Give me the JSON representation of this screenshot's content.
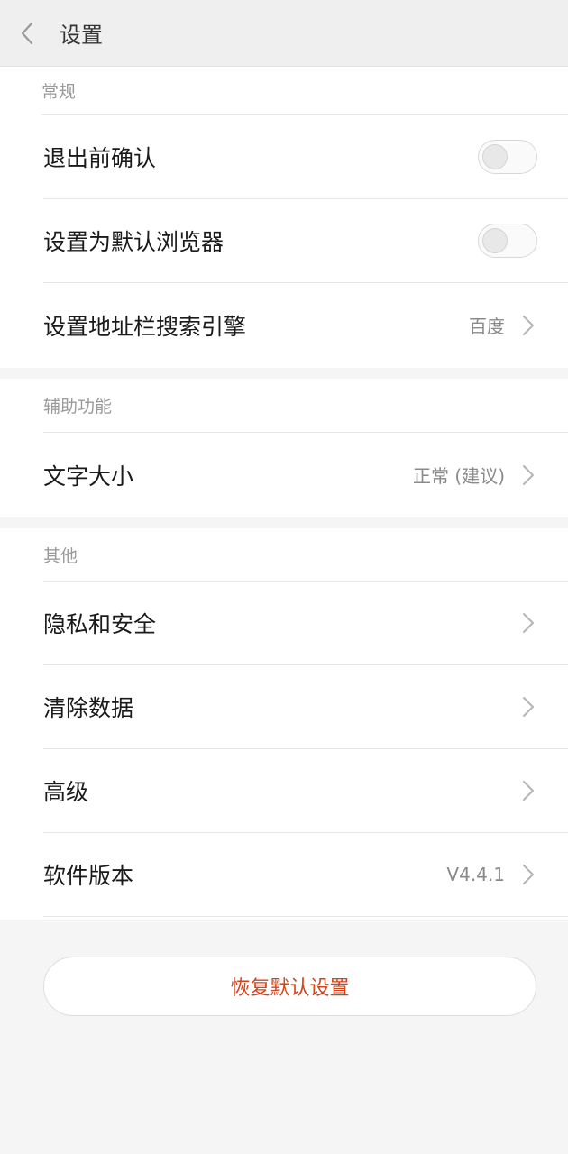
{
  "header": {
    "title": "设置",
    "back_icon": "chevron-left-icon"
  },
  "sections": {
    "general": {
      "title": "常规",
      "items": [
        {
          "label": "退出前确认",
          "type": "toggle",
          "on": false
        },
        {
          "label": "设置为默认浏览器",
          "type": "toggle",
          "on": false
        },
        {
          "label": "设置地址栏搜索引擎",
          "type": "link",
          "value": "百度"
        }
      ]
    },
    "accessibility": {
      "title": "辅助功能",
      "items": [
        {
          "label": "文字大小",
          "type": "link",
          "value": "正常 (建议)"
        }
      ]
    },
    "other": {
      "title": "其他",
      "items": [
        {
          "label": "隐私和安全",
          "type": "link"
        },
        {
          "label": "清除数据",
          "type": "link"
        },
        {
          "label": "高级",
          "type": "link"
        },
        {
          "label": "软件版本",
          "type": "link",
          "value": "V4.4.1"
        }
      ]
    }
  },
  "restore_button": {
    "label": "恢复默认设置",
    "color": "#d2441c"
  }
}
